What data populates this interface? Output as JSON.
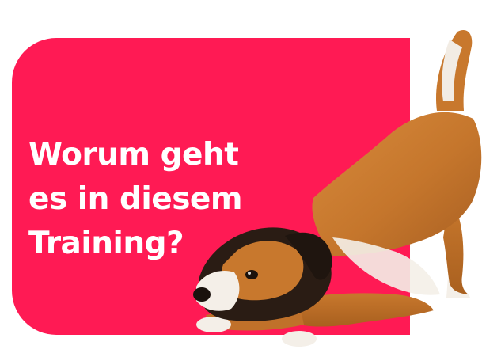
{
  "headline": {
    "line1": "Worum geht",
    "line2": "es in diesem",
    "line3": "Training?"
  },
  "colors": {
    "panel": "#ff1a54",
    "headline_text": "#ffffff",
    "dog_fur": "#c8782d",
    "dog_dark": "#2a1c14",
    "dog_white": "#f4efe8"
  },
  "illustration": {
    "subject": "dog-play-bow-photo"
  }
}
